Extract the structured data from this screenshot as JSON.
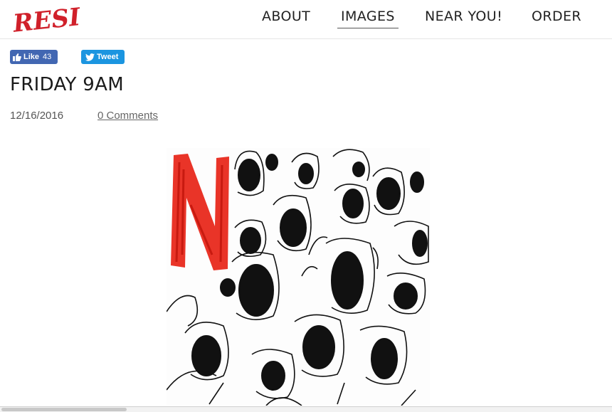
{
  "brand": {
    "logo_text": "RESIST!",
    "logo_color": "#d0202a"
  },
  "nav": {
    "items": [
      {
        "label": "ABOUT"
      },
      {
        "label": "IMAGES",
        "active": true
      },
      {
        "label": "NEAR YOU!"
      },
      {
        "label": "ORDER"
      }
    ]
  },
  "social": {
    "like_label": "Like",
    "like_count": "43",
    "tweet_label": "Tweet",
    "facebook_color": "#4267b2",
    "twitter_color": "#1b95e0"
  },
  "post": {
    "title": "FRIDAY 9AM",
    "date": "12/16/2016",
    "comments": "0 Comments",
    "artwork": {
      "letters": "N",
      "letter_color": "#e8291c",
      "subject": "crowd of screaming faces ink drawing"
    }
  }
}
